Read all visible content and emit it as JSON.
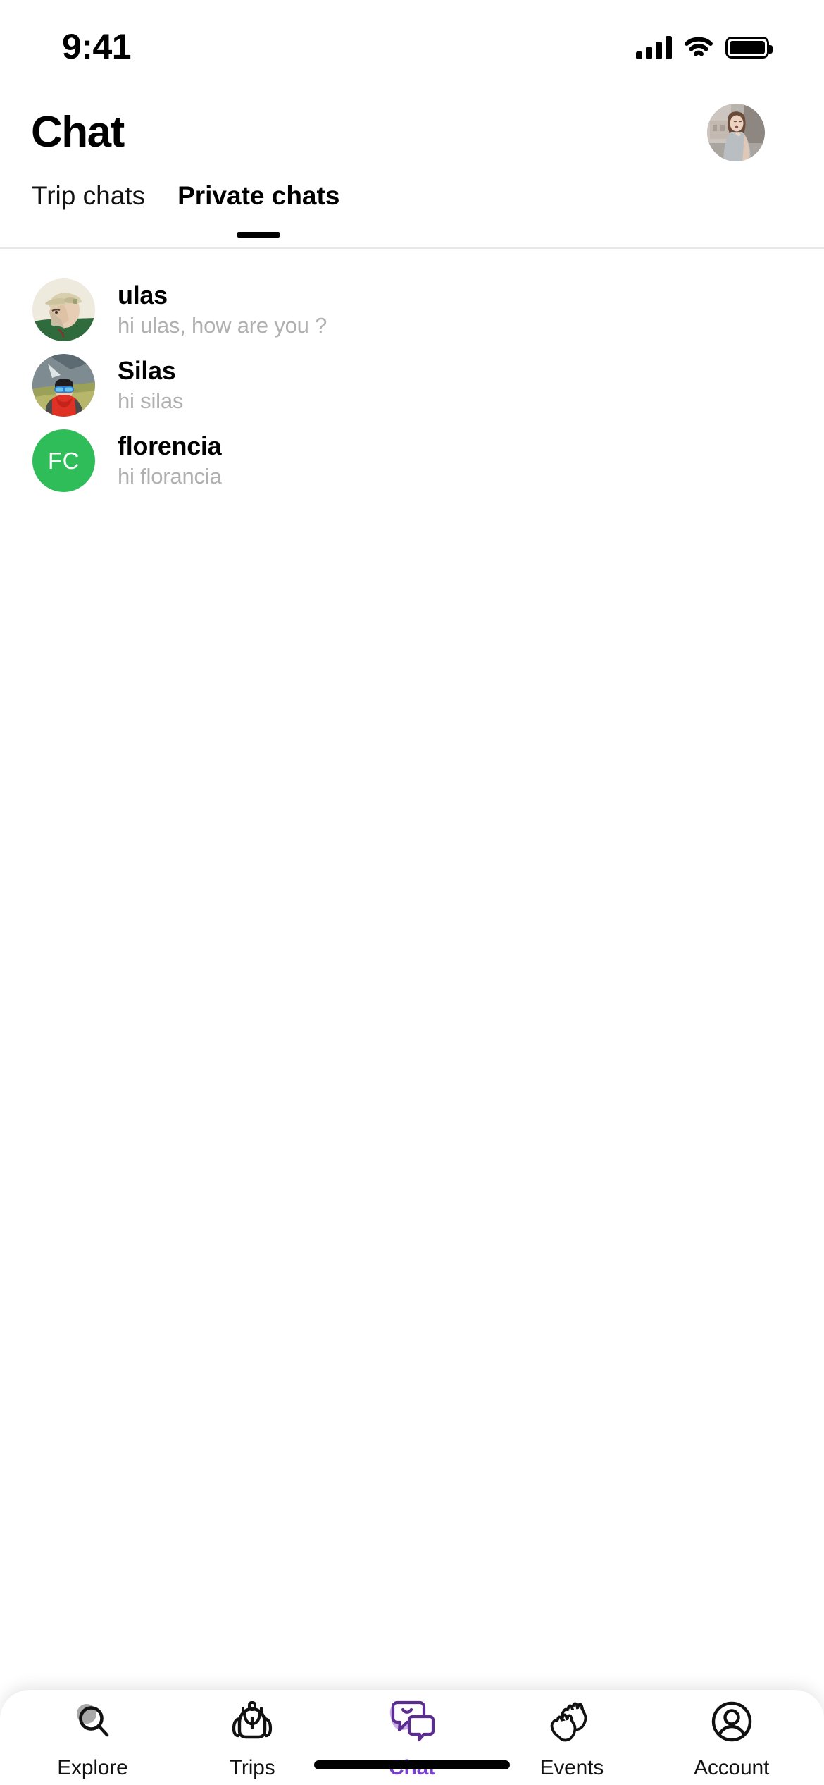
{
  "status_bar": {
    "time": "9:41",
    "signal_icon": "cellular-signal-icon",
    "wifi_icon": "wifi-icon",
    "battery_icon": "battery-full-icon"
  },
  "header": {
    "title": "Chat",
    "avatar_icon": "profile-avatar-photo"
  },
  "tabs": {
    "items": [
      {
        "label": "Trip chats",
        "active": false
      },
      {
        "label": "Private chats",
        "active": true
      }
    ]
  },
  "chat_list": {
    "items": [
      {
        "name": "ulas",
        "message": "hi ulas, how are you ?",
        "avatar_type": "photo",
        "avatar_name": "avatar-photo-ulas"
      },
      {
        "name": "Silas",
        "message": "hi silas",
        "avatar_type": "photo",
        "avatar_name": "avatar-photo-silas"
      },
      {
        "name": "florencia",
        "message": "hi florancia",
        "avatar_type": "initials",
        "avatar_name": "avatar-initials-florencia",
        "initials": "FC",
        "avatar_color": "#2ebd59"
      }
    ]
  },
  "bottom_nav": {
    "items": [
      {
        "label": "Explore",
        "icon": "search-icon",
        "active": false
      },
      {
        "label": "Trips",
        "icon": "backpack-icon",
        "active": false
      },
      {
        "label": "Chat",
        "icon": "chat-bubbles-icon",
        "active": true
      },
      {
        "label": "Events",
        "icon": "clapping-hands-icon",
        "active": false
      },
      {
        "label": "Account",
        "icon": "user-circle-icon",
        "active": false
      }
    ],
    "active_color": "#7B3FCF",
    "inactive_color": "#111111"
  },
  "home_indicator": "home-indicator-bar"
}
